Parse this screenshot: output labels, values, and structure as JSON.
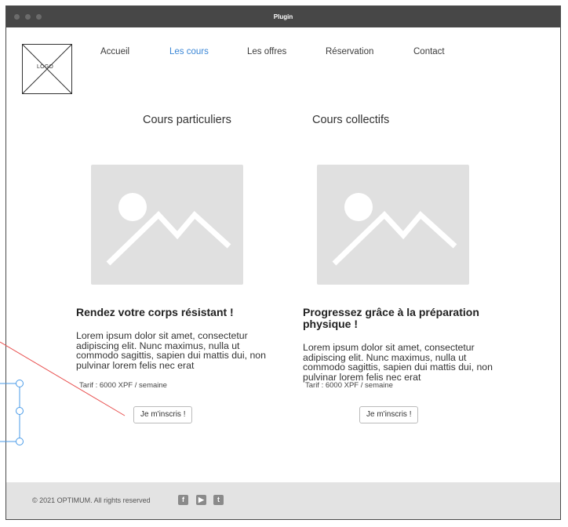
{
  "window": {
    "title": "Plugin"
  },
  "logo": {
    "label": "LOGO"
  },
  "nav": {
    "items": [
      {
        "label": "Accueil"
      },
      {
        "label": "Les cours"
      },
      {
        "label": "Les offres"
      },
      {
        "label": "Réservation"
      },
      {
        "label": "Contact"
      }
    ],
    "active": "Les cours"
  },
  "courses": [
    {
      "category": "Cours particuliers",
      "heading": "Rendez votre corps résistant !",
      "body": "Lorem ipsum dolor sit amet, consectetur adipiscing elit. Nunc maximus, nulla ut commodo sagittis, sapien dui mattis dui, non pulvinar lorem felis nec erat",
      "tarif": "Tarif : 6000 XPF / semaine",
      "button": "Je m'inscris !"
    },
    {
      "category": "Cours collectifs",
      "heading": "Progressez grâce à la préparation physique !",
      "body": "Lorem ipsum dolor sit amet, consectetur adipiscing elit. Nunc maximus, nulla ut commodo sagittis, sapien dui mattis dui, non pulvinar lorem felis nec erat",
      "tarif": "Tarif : 6000 XPF / semaine",
      "button": "Je m'inscris !"
    }
  ],
  "footer": {
    "copyright": "© 2021 OPTIMUM. All rights reserved",
    "social_icons": [
      "facebook-icon",
      "youtube-icon",
      "twitter-icon"
    ]
  },
  "colors": {
    "titlebar": "#474747",
    "active_nav": "#3a86d6",
    "placeholder": "#e0e0e0",
    "footer": "#e3e3e3",
    "annotation_red": "#e8504f",
    "annotation_blue": "#4a9be8"
  }
}
